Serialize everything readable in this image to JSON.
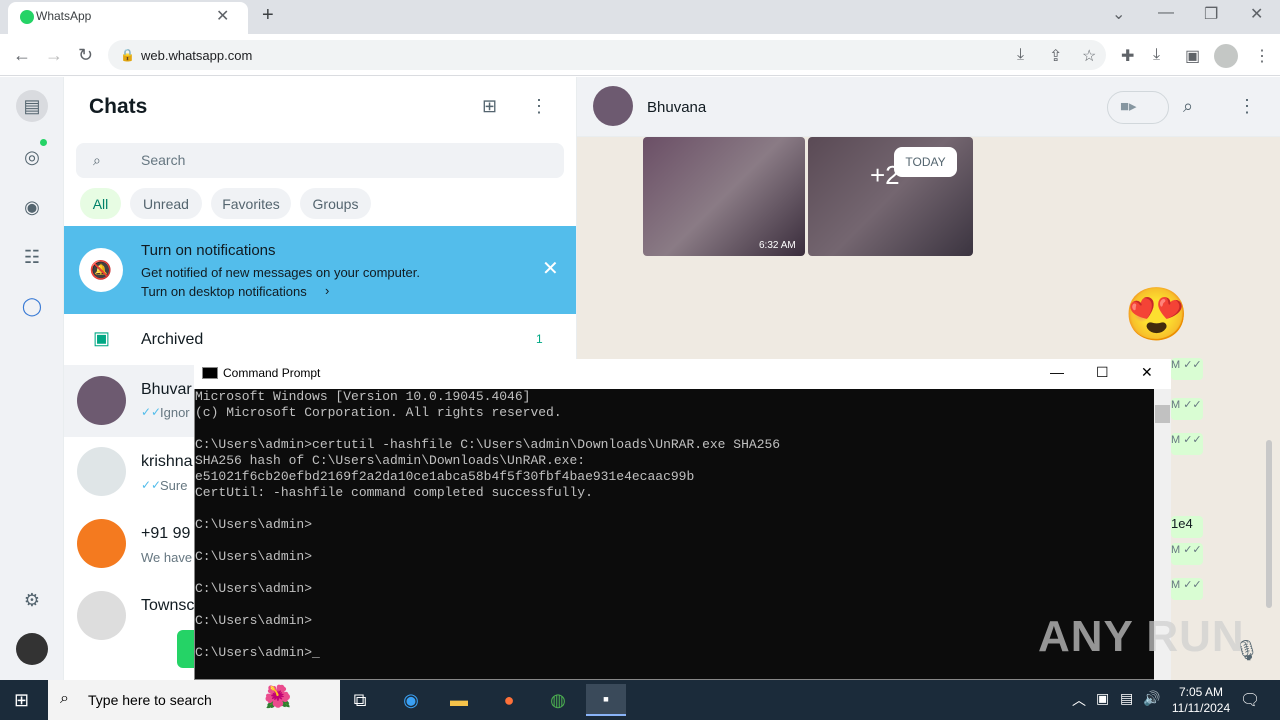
{
  "browser": {
    "tab_title": "WhatsApp",
    "tab_close": "✕",
    "new_tab": "+",
    "url": "web.whatsapp.com"
  },
  "whatsapp": {
    "chats_title": "Chats",
    "search_placeholder": "Search",
    "filters": [
      "All",
      "Unread",
      "Favorites",
      "Groups"
    ],
    "notification": {
      "title": "Turn on notifications",
      "subtitle": "Get notified of new messages on your computer.",
      "link": "Turn on desktop notifications"
    },
    "archived": {
      "label": "Archived",
      "count": "1"
    },
    "chats": [
      {
        "name": "Bhuvar",
        "preview": "Ignor"
      },
      {
        "name": "krishna",
        "preview": "Sure"
      },
      {
        "name": "+91 99",
        "preview": "We have"
      },
      {
        "name": "Townsc",
        "preview": ""
      }
    ],
    "conversation": {
      "contact_name": "Bhuvana",
      "image_time": "6:32 AM",
      "more_count": "+2",
      "date_divider": "TODAY",
      "emoji": "😍",
      "fragment_text": "1e4",
      "tick_text": "M ✓✓"
    }
  },
  "cmd": {
    "title": "Command Prompt",
    "lines": [
      "Microsoft Windows [Version 10.0.19045.4046]",
      "(c) Microsoft Corporation. All rights reserved.",
      "",
      "C:\\Users\\admin>certutil -hashfile C:\\Users\\admin\\Downloads\\UnRAR.exe SHA256",
      "SHA256 hash of C:\\Users\\admin\\Downloads\\UnRAR.exe:",
      "e51021f6cb20efbd2169f2a2da10ce1abca58b4f5f30fbf4bae931e4ecaac99b",
      "CertUtil: -hashfile command completed successfully.",
      "",
      "C:\\Users\\admin>",
      "",
      "C:\\Users\\admin>",
      "",
      "C:\\Users\\admin>",
      "",
      "C:\\Users\\admin>",
      "",
      "C:\\Users\\admin>_"
    ]
  },
  "watermark": "ANY RUN",
  "taskbar": {
    "search_placeholder": "Type here to search",
    "time": "7:05 AM",
    "date": "11/11/2024"
  },
  "colors": {
    "wa_green": "#25d366",
    "notif_blue": "#53bdeb",
    "taskbar": "#1b2b3a"
  }
}
